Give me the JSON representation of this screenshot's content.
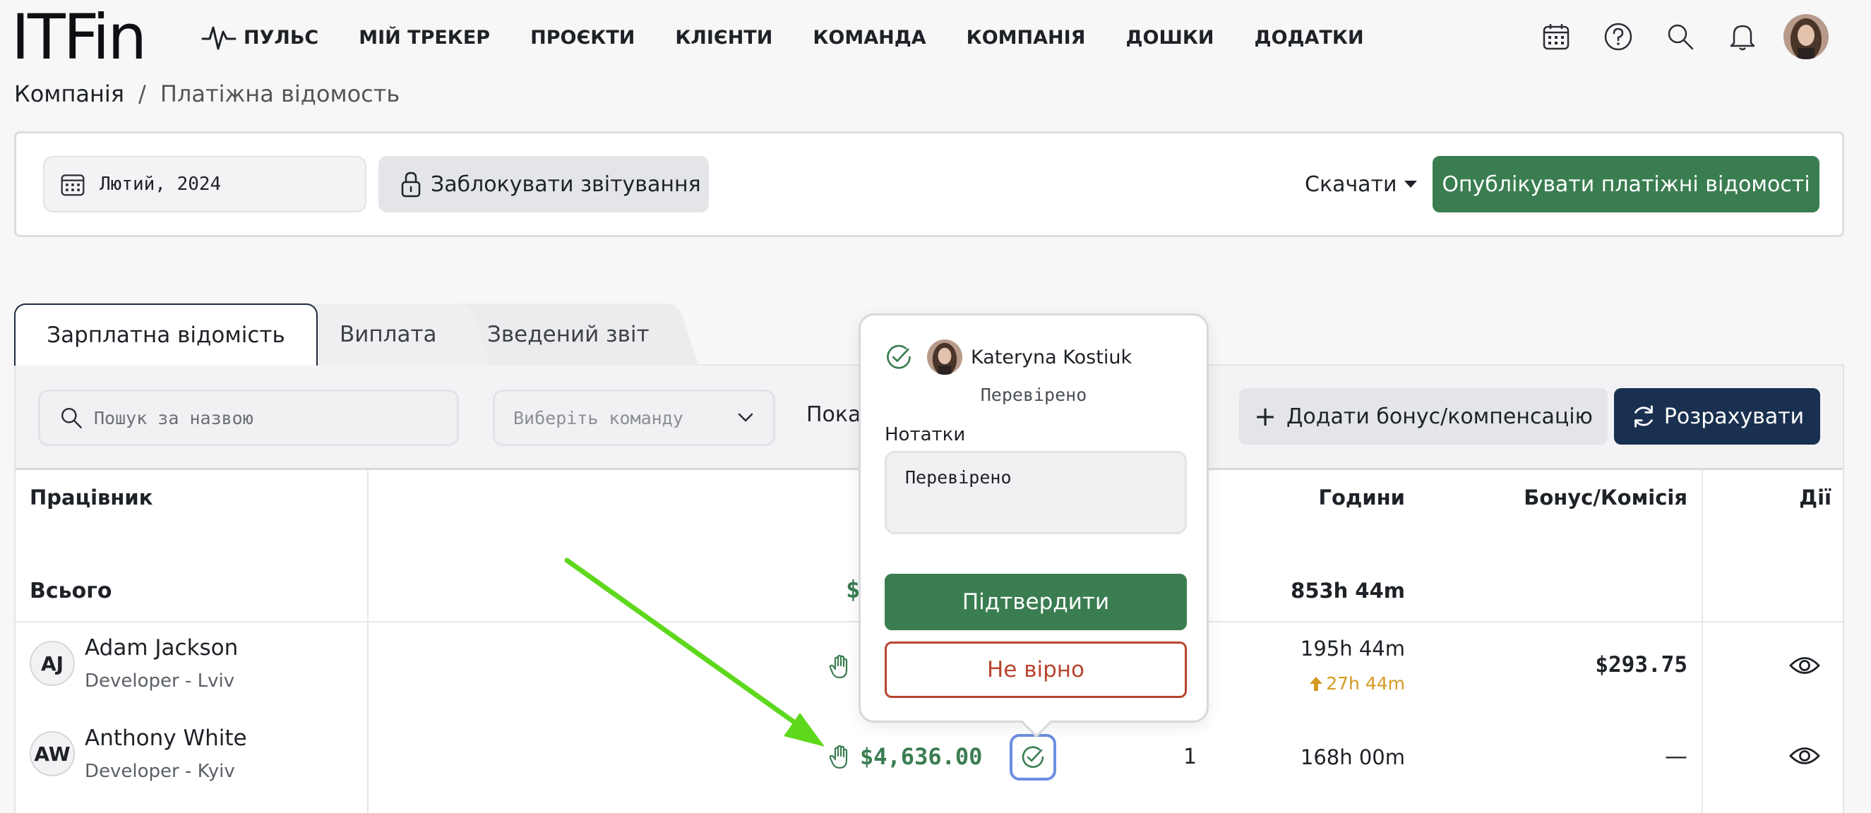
{
  "app": {
    "logo": "ITFin"
  },
  "nav": {
    "items": [
      {
        "label": "ПУЛЬС"
      },
      {
        "label": "МІЙ ТРЕКЕР"
      },
      {
        "label": "ПРОЄКТИ"
      },
      {
        "label": "КЛІЄНТИ"
      },
      {
        "label": "КОМАНДА"
      },
      {
        "label": "КОМПАНІЯ"
      },
      {
        "label": "ДОШКИ"
      },
      {
        "label": "ДОДАТКИ"
      }
    ],
    "icons": [
      "calendar-icon",
      "help-icon",
      "search-icon",
      "bell-icon",
      "user-avatar"
    ]
  },
  "breadcrumb": {
    "root": "Компанія",
    "separator": "/",
    "current": "Платіжна відомость"
  },
  "filters": {
    "period": "Лютий, 2024",
    "lock_label": "Заблокувати звітування",
    "download_label": "Скачати",
    "publish_label": "Опублікувати платіжні відомості"
  },
  "tabs": [
    {
      "label": "Зарплатна відомість",
      "active": true
    },
    {
      "label": "Виплата",
      "active": false
    },
    {
      "label": "Зведений звіт",
      "active": false
    }
  ],
  "toolbar": {
    "search_placeholder": "Пошук за назвою",
    "team_placeholder": "Виберіть команду",
    "show_label": "Пока",
    "add_bonus_label": "Додати бонус/компенсацію",
    "calculate_label": "Розрахувати"
  },
  "table": {
    "headers": {
      "employee": "Працівник",
      "hours": "Години",
      "bonus": "Бонус/Комісія",
      "actions": "Дії"
    },
    "total": {
      "label": "Всього",
      "amount": "$",
      "hours": "853h 44m"
    },
    "rows": [
      {
        "initials": "AJ",
        "name": "Adam Jackson",
        "role": "Developer - Lviv",
        "hours": "195h 44m",
        "overtime": "27h 44m",
        "bonus": "$293.75"
      },
      {
        "initials": "AW",
        "name": "Anthony White",
        "role": "Developer - Kyiv",
        "amount": "$4,636.00",
        "count": "1",
        "hours": "168h 00m",
        "bonus": "—"
      }
    ]
  },
  "popover": {
    "user_name": "Kateryna Kostiuk",
    "status": "Перевірено",
    "notes_label": "Нотатки",
    "notes_value": "Перевірено",
    "confirm_label": "Підтвердити",
    "wrong_label": "Не вірно"
  },
  "colors": {
    "accent_green": "#3a7d51",
    "navy": "#1a3050",
    "danger": "#b8442f",
    "arrow": "#5ed81c",
    "overtime": "#d49a21"
  }
}
